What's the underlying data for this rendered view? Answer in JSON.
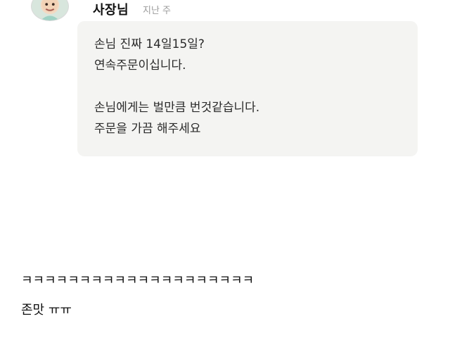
{
  "reply": {
    "author": "사장님",
    "time": "지난 주",
    "lines": [
      "손님 진짜 14일15일?",
      "연속주문이십니다.",
      "",
      "손님에게는 벌만큼 번것같습니다.",
      "주문을 가끔 해주세요"
    ],
    "avatar_icon": "owner-avatar-icon",
    "bubble_color": "#f4f4f2"
  },
  "comment": {
    "line1": "ㅋㅋㅋㅋㅋㅋㅋㅋㅋㅋㅋㅋㅋㅋㅋㅋㅋㅋㅋㅋ",
    "line2": "존맛 ㅠㅠ"
  }
}
